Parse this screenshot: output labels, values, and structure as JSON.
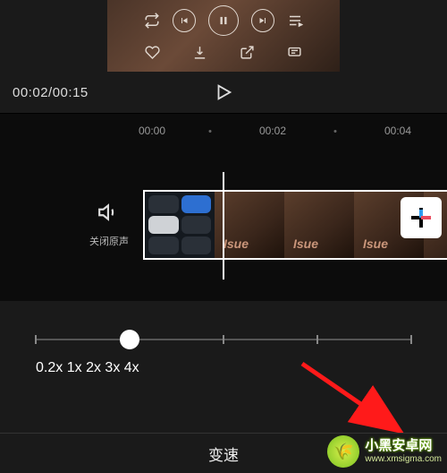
{
  "preview": {
    "icons": {
      "loop": "loop-icon",
      "prev": "skip-previous-icon",
      "pause": "pause-icon",
      "next": "skip-next-icon",
      "playlist": "playlist-icon",
      "like": "heart-icon",
      "download": "download-icon",
      "share": "open-external-icon",
      "comment": "comment-icon"
    }
  },
  "timebar": {
    "current": "00:02",
    "separator": "/",
    "total": "00:15",
    "play_icon": "play-icon"
  },
  "ruler": {
    "marks": [
      {
        "label": "00:00",
        "pos": 170
      },
      {
        "dot": true,
        "pos": 235
      },
      {
        "label": "00:02",
        "pos": 305
      },
      {
        "dot": true,
        "pos": 375
      },
      {
        "label": "00:04",
        "pos": 445
      }
    ]
  },
  "timeline": {
    "mute_label": "关闭原声",
    "add_icon": "plus-icon",
    "thumb_overlay": "Isue"
  },
  "speed": {
    "options": [
      "0.2x",
      "1x",
      "2x",
      "3x",
      "4x"
    ],
    "selected_index": 1
  },
  "bottom": {
    "title": "变速"
  },
  "watermark": {
    "line1": "小黑安卓网",
    "line2": "www.xmsigma.com",
    "emoji": "🌾"
  }
}
